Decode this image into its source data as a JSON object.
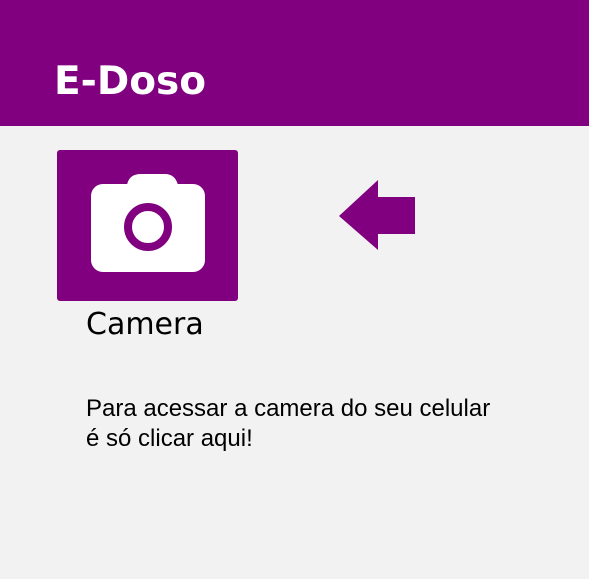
{
  "app": {
    "title": "E-Doso"
  },
  "camera": {
    "label": "Camera",
    "icon": "camera-icon",
    "description_line1": "Para acessar a camera do seu celular",
    "description_line2": "é só clicar aqui!"
  },
  "pointer": {
    "icon": "arrow-left-icon"
  },
  "colors": {
    "brand": "#800080",
    "background": "#f2f2f2",
    "text": "#000000",
    "icon_fill": "#ffffff"
  }
}
